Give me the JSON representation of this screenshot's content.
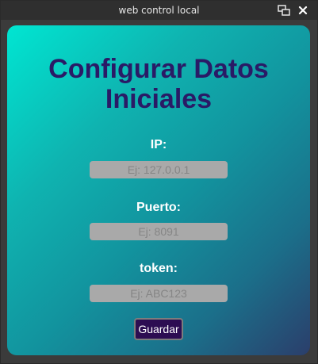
{
  "window": {
    "title": "web control local",
    "controls": [
      "restore-icon",
      "close-icon"
    ]
  },
  "form": {
    "heading_line1": "Configurar Datos",
    "heading_line2": "Iniciales",
    "ip": {
      "label": "IP:",
      "value": "",
      "placeholder": "Ej: 127.0.0.1"
    },
    "port": {
      "label": "Puerto:",
      "value": "",
      "placeholder": "Ej: 8091"
    },
    "token": {
      "label": "token:",
      "value": "",
      "placeholder": "Ej: ABC123"
    },
    "save_label": "Guardar"
  },
  "colors": {
    "gradient_start": "#00e6d2",
    "gradient_end": "#2b3e6b",
    "heading": "#2a1a66",
    "button_bg": "#2d0d52",
    "field_bg": "#a9a9a9"
  }
}
